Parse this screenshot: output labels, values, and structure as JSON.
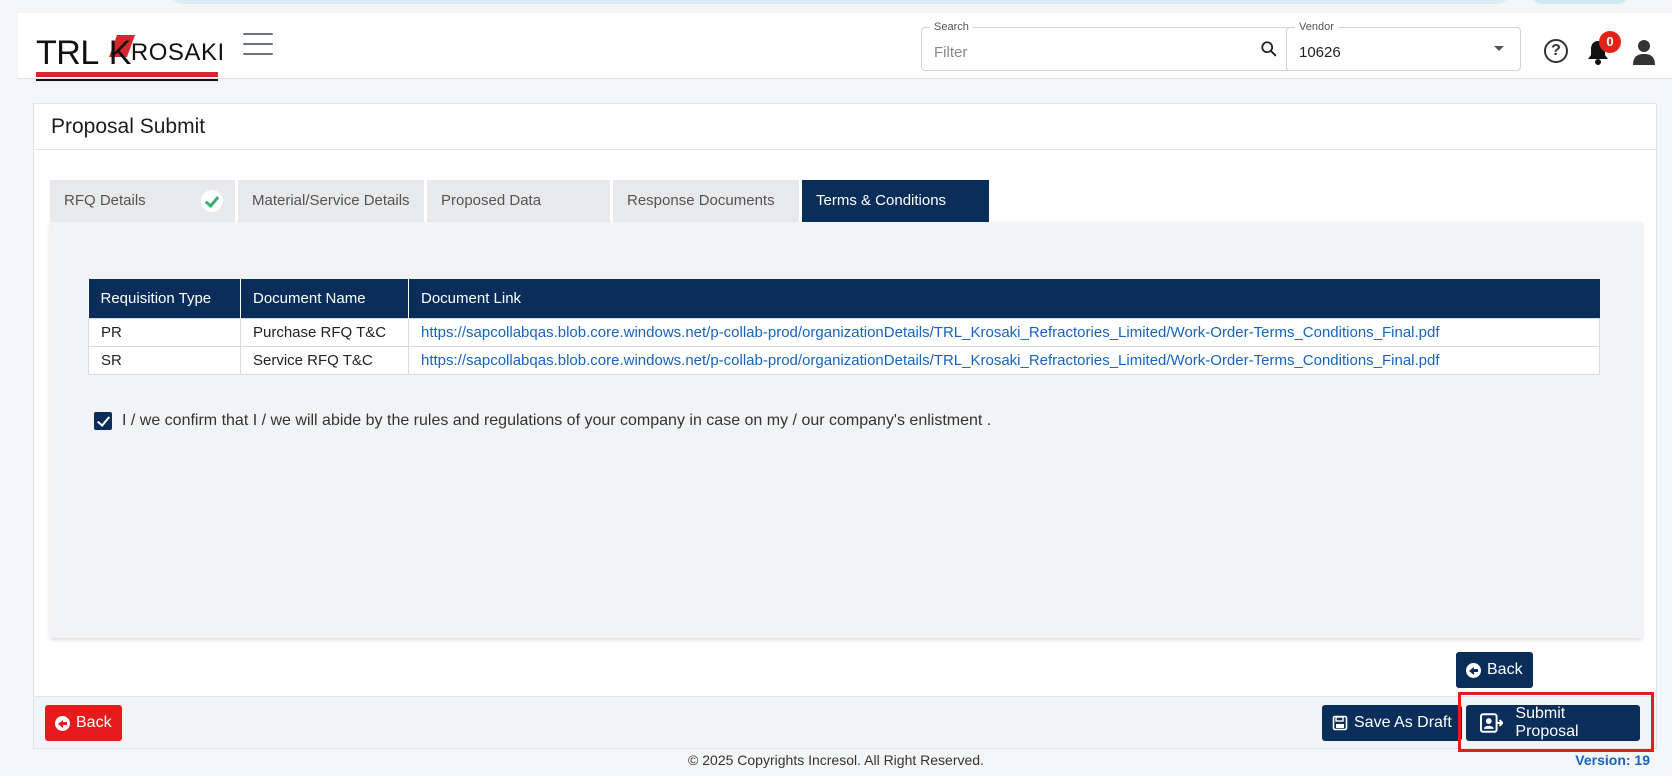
{
  "header": {
    "logo": {
      "part1": "TRL",
      "part2": "K",
      "part3": "ROSAKI"
    },
    "search": {
      "label": "Search",
      "placeholder": "Filter"
    },
    "vendor": {
      "label": "Vendor",
      "value": "10626"
    },
    "notifications_count": "0"
  },
  "page": {
    "title": "Proposal Submit"
  },
  "tabs": [
    {
      "label": "RFQ Details",
      "completed": true
    },
    {
      "label": "Material/Service Details"
    },
    {
      "label": "Proposed Data"
    },
    {
      "label": "Response Documents"
    },
    {
      "label": "Terms & Conditions",
      "active": true
    }
  ],
  "documents_table": {
    "headers": [
      "Requisition Type",
      "Document Name",
      "Document Link"
    ],
    "rows": [
      {
        "type": "PR",
        "name": "Purchase RFQ T&C",
        "link": "https://sapcollabqas.blob.core.windows.net/p-collab-prod/organizationDetails/TRL_Krosaki_Refractories_Limited/Work-Order-Terms_Conditions_Final.pdf"
      },
      {
        "type": "SR",
        "name": "Service RFQ T&C",
        "link": "https://sapcollabqas.blob.core.windows.net/p-collab-prod/organizationDetails/TRL_Krosaki_Refractories_Limited/Work-Order-Terms_Conditions_Final.pdf"
      }
    ]
  },
  "confirm": {
    "checked": true,
    "text": "I / we confirm that I / we will abide by the rules and regulations of your company in case on my / our company's enlistment ."
  },
  "buttons": {
    "inner_back": "Back",
    "footer_back": "Back",
    "save_draft": "Save As Draft",
    "submit": "Submit Proposal"
  },
  "footer": {
    "copyright": "© 2025 Copyrights Incresol. All Right Reserved.",
    "version": "Version: 19"
  },
  "colors": {
    "primary": "#0a2d5a",
    "danger": "#e61b1b",
    "link": "#1565c0",
    "success": "#3bb26b"
  }
}
